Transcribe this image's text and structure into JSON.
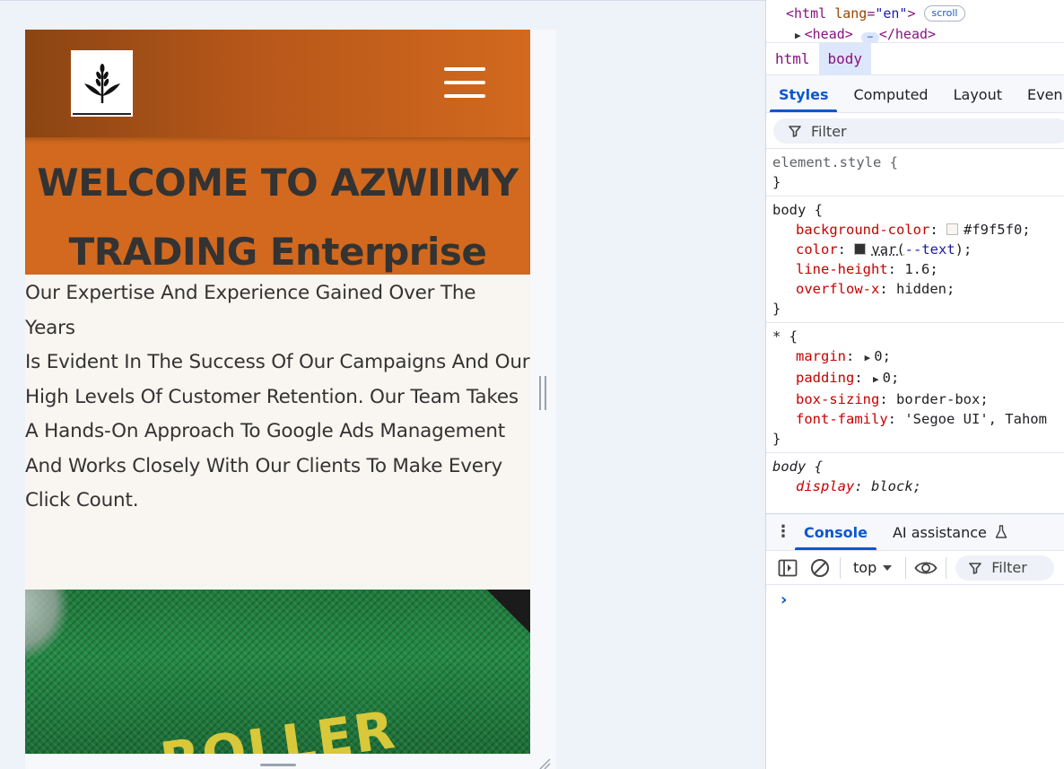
{
  "site": {
    "hero_line1": "WELCOME TO AZWIIMY",
    "hero_line2": "TRADING Enterprise",
    "intro_lines": [
      "Our Expertise And Experience Gained Over The Years",
      "Is Evident In The Success Of Our Campaigns And Our",
      "High Levels Of Customer Retention. Our Team Takes",
      "A Hands-On Approach To Google Ads Management",
      "And Works Closely With Our Clients To Make Every",
      "Click Count."
    ],
    "photo_text": "ROLLER",
    "colors": {
      "header_start": "#8b4513",
      "header_end": "#d2691e",
      "hero_bg": "#d2691e",
      "body_bg": "#f9f5f0",
      "text": "#333333"
    }
  },
  "devtools": {
    "dom": {
      "html_tag": "<html",
      "lang_attr": "lang",
      "lang_val": "\"en\"",
      "close_angle": ">",
      "scroll_badge": "scroll",
      "head_open": "<head>",
      "head_close": "</head>"
    },
    "breadcrumbs": [
      "html",
      "body"
    ],
    "tabs": [
      "Styles",
      "Computed",
      "Layout",
      "Even"
    ],
    "filter_placeholder": "Filter",
    "rules": {
      "element_style": "element.style {",
      "close": "}",
      "body_sel": "body {",
      "body_decls": [
        {
          "prop": "background-color",
          "val": "#f9f5f0;",
          "swatch": "#f9f5f0"
        },
        {
          "prop": "color",
          "val_fn": "var(",
          "val_var": "--text",
          "val_end": ");",
          "swatch": "#333333"
        },
        {
          "prop": "line-height",
          "val": "1.6;"
        },
        {
          "prop": "overflow-x",
          "val": "hidden;"
        }
      ],
      "star_sel": "* {",
      "star_decls": [
        {
          "prop": "margin",
          "val": "0;",
          "arrow": true
        },
        {
          "prop": "padding",
          "val": "0;",
          "arrow": true
        },
        {
          "prop": "box-sizing",
          "val": "border-box;"
        },
        {
          "prop": "font-family",
          "val": "'Segoe UI', Tahom"
        }
      ],
      "ua_sel": "body {",
      "ua_decls": [
        {
          "prop": "display",
          "val": "block;"
        }
      ]
    },
    "drawer": {
      "tabs": [
        "Console",
        "AI assistance"
      ],
      "context": "top",
      "filter": "Filter",
      "prompt": "›"
    }
  }
}
